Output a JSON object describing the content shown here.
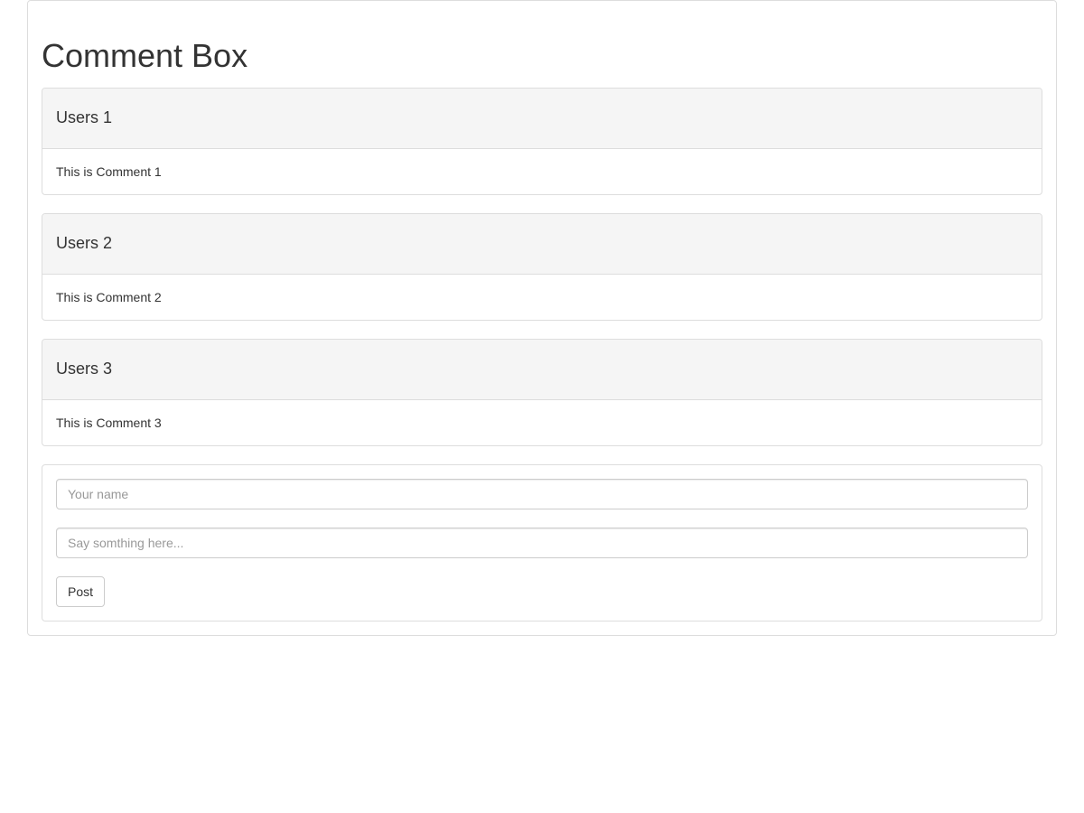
{
  "title": "Comment Box",
  "comments": [
    {
      "user": "Users 1",
      "text": "This is Comment 1"
    },
    {
      "user": "Users 2",
      "text": "This is Comment 2"
    },
    {
      "user": "Users 3",
      "text": "This is Comment 3"
    }
  ],
  "form": {
    "name_placeholder": "Your name",
    "comment_placeholder": "Say somthing here...",
    "submit_label": "Post"
  }
}
